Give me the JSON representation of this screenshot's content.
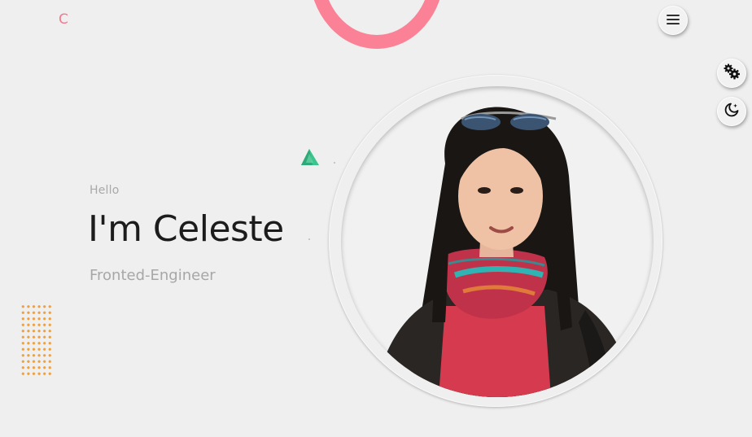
{
  "header": {
    "logo_text": "C",
    "menu_icon": "hamburger-menu-icon"
  },
  "side_controls": {
    "settings_icon": "gears-icon",
    "theme_icon": "moon-star-icon"
  },
  "hero": {
    "greeting": "Hello",
    "name": "I'm Celeste",
    "role": "Fronted-Engineer",
    "portrait_icon": "profile-photo"
  },
  "colors": {
    "accent": "#fb8296",
    "logo": "#f47a8e",
    "dots": "#f0a03a",
    "triangle": "#3cc48e",
    "background": "#efefef"
  }
}
